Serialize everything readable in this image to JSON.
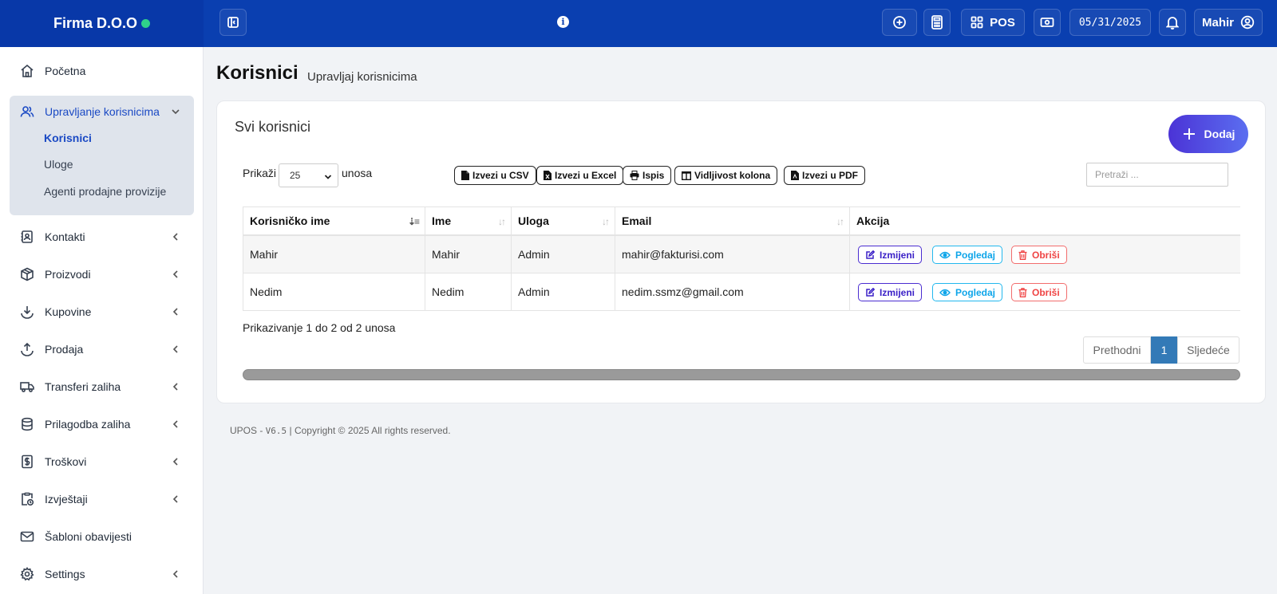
{
  "brand": {
    "name": "Firma D.O.O"
  },
  "topbar": {
    "pos_label": "POS",
    "date": "05/31/2025",
    "user": "Mahir"
  },
  "sidebar": {
    "items": [
      {
        "label": "Početna"
      },
      {
        "label": "Upravljanje korisnicima"
      },
      {
        "label": "Kontakti"
      },
      {
        "label": "Proizvodi"
      },
      {
        "label": "Kupovine"
      },
      {
        "label": "Prodaja"
      },
      {
        "label": "Transferi zaliha"
      },
      {
        "label": "Prilagodba zaliha"
      },
      {
        "label": "Troškovi"
      },
      {
        "label": "Izvještaji"
      },
      {
        "label": "Šabloni obavijesti"
      },
      {
        "label": "Settings"
      }
    ],
    "subitems": [
      {
        "label": "Korisnici"
      },
      {
        "label": "Uloge"
      },
      {
        "label": "Agenti prodajne provizije"
      }
    ]
  },
  "page": {
    "title": "Korisnici",
    "subtitle": "Upravljaj korisnicima"
  },
  "card": {
    "title": "Svi korisnici",
    "add_label": "Dodaj",
    "show_label": "Prikaži",
    "page_size": "25",
    "entries_label": "unosa",
    "search_placeholder": "Pretraži ...",
    "export": {
      "csv": "Izvezi u CSV",
      "excel": "Izvezi u Excel",
      "print": "Ispis",
      "columns": "Vidljivost kolona",
      "pdf": "Izvezi u PDF"
    }
  },
  "table": {
    "headers": [
      "Korisničko ime",
      "Ime",
      "Uloga",
      "Email",
      "Akcija"
    ],
    "rows": [
      {
        "username": "Mahir",
        "name": "Mahir",
        "role": "Admin",
        "email": "mahir@fakturisi.com"
      },
      {
        "username": "Nedim",
        "name": "Nedim",
        "role": "Admin",
        "email": "nedim.ssmz@gmail.com"
      }
    ],
    "actions": {
      "edit": "Izmijeni",
      "view": "Pogledaj",
      "delete": "Obriši"
    },
    "info": "Prikazivanje 1 do 2 od 2 unosa",
    "pager": {
      "prev": "Prethodni",
      "current": "1",
      "next": "Sljedeće"
    }
  },
  "footer": {
    "app": "UPOS - ",
    "version": "V6.5",
    "copyright": " | Copyright © 2025 All rights reserved."
  }
}
